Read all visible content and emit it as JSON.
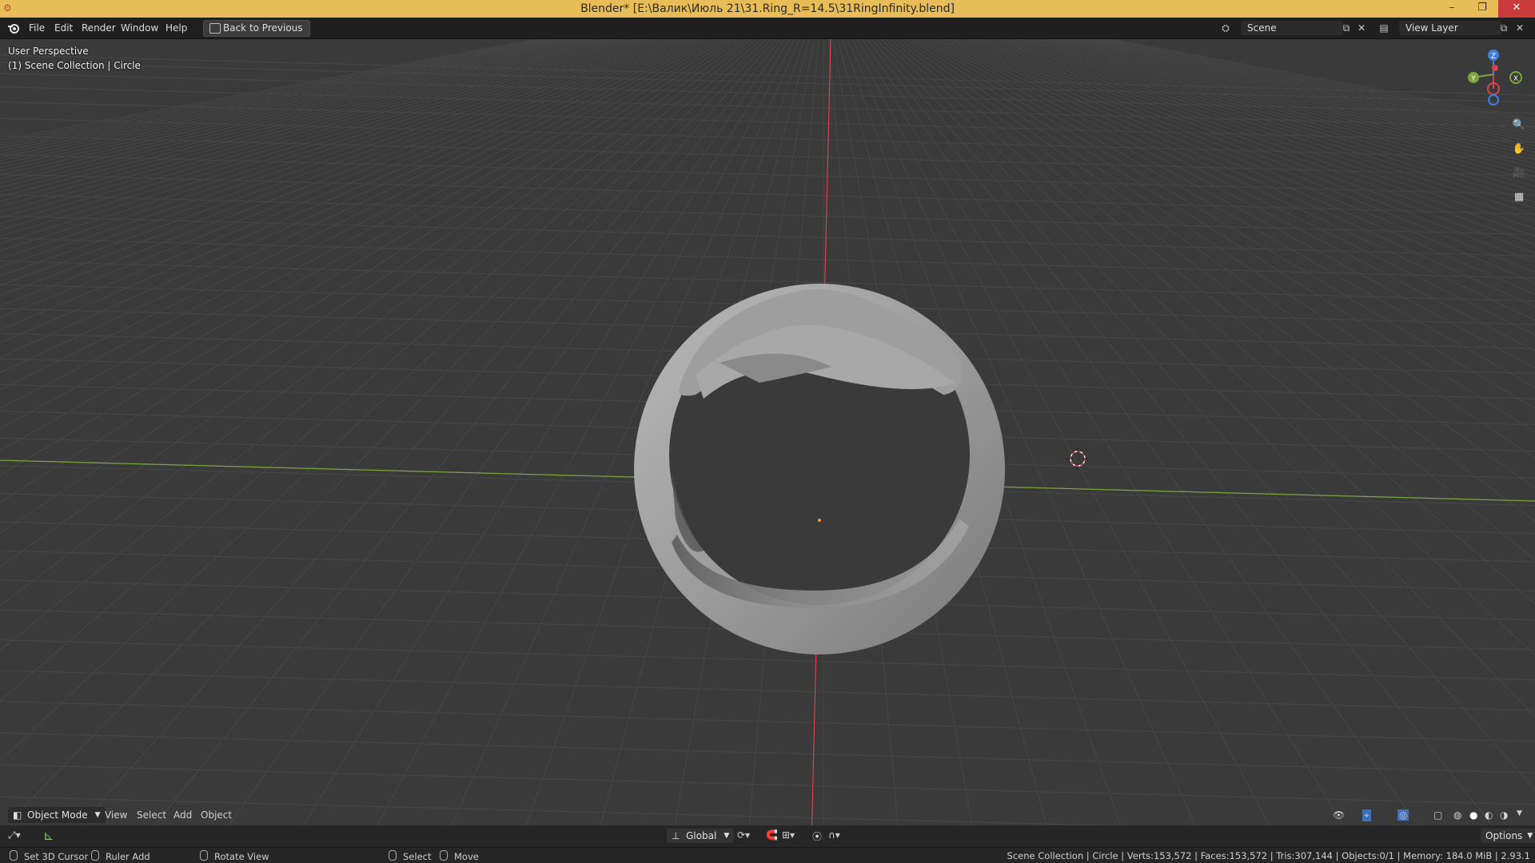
{
  "window": {
    "title": "Blender* [E:\\Валик\\Июль 21\\31.Ring_R=14.5\\31RingInfinity.blend]",
    "minimize_icon": "minimize-icon",
    "restore_icon": "restore-icon",
    "close_icon": "close-icon"
  },
  "menubar": {
    "items": [
      "File",
      "Edit",
      "Render",
      "Window",
      "Help"
    ],
    "back_button": "Back to Previous",
    "scene_field": "Scene",
    "view_layer_field": "View Layer"
  },
  "viewport": {
    "perspective_label": "User Perspective",
    "collection_label": "(1) Scene Collection | Circle",
    "gizmo_axes": [
      "Z",
      "Y",
      "X"
    ],
    "colors": {
      "x_axis": "#d9424c",
      "y_axis": "#7aa63d",
      "z_axis": "#3d7fd9",
      "grid_bg": "#3a3a3a"
    }
  },
  "header": {
    "mode": "Object Mode",
    "menus": [
      "View",
      "Select",
      "Add",
      "Object"
    ]
  },
  "toolbar": {
    "transform_orientation": "Global",
    "options_label": "Options"
  },
  "statusbar": {
    "left": [
      {
        "label": "Set 3D Cursor"
      },
      {
        "label": "Ruler Add"
      },
      {
        "label": "Rotate View"
      },
      {
        "label": "Select"
      },
      {
        "label": "Move"
      }
    ],
    "stats": "Scene Collection | Circle | Verts:153,572 | Faces:153,572 | Tris:307,144 | Objects:0/1 | Memory: 184.0 MiB | 2.93.1"
  }
}
